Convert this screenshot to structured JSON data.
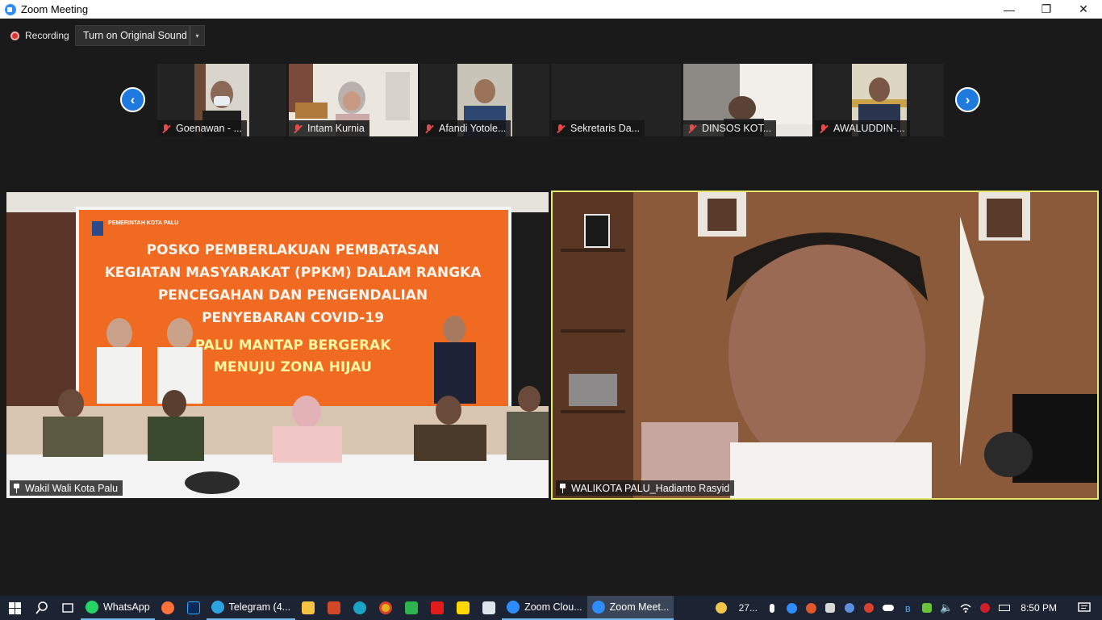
{
  "window": {
    "title": "Zoom Meeting",
    "minimize": "—",
    "restore": "❐",
    "close": "✕"
  },
  "toolbar": {
    "recording_label": "Recording",
    "original_sound_label": "Turn on Original Sound",
    "dropdown_glyph": "▾"
  },
  "gallery": {
    "prev_glyph": "‹",
    "next_glyph": "›",
    "thumbnails": [
      {
        "name": "Goenawan - ..."
      },
      {
        "name": "Intam Kurnia"
      },
      {
        "name": "Afandi Yotole..."
      },
      {
        "name": "Sekretaris Da..."
      },
      {
        "name": "DINSOS KOT..."
      },
      {
        "name": "AWALUDDIN-..."
      }
    ]
  },
  "videos": {
    "left": {
      "label": "Wakil Wali Kota Palu",
      "banner": {
        "org": "PEMERINTAH\nKOTA PALU",
        "line1": "POSKO PEMBERLAKUAN PEMBATASAN",
        "line2": "KEGIATAN MASYARAKAT (PPKM) DALAM RANGKA",
        "line3": "PENCEGAHAN DAN PENGENDALIAN",
        "line4": "PENYEBARAN COVID-19",
        "line5": "PALU MANTAP BERGERAK",
        "line6": "MENUJU ZONA HIJAU"
      }
    },
    "right": {
      "label": "WALIKOTA PALU_Hadianto Rasyid",
      "active_border": "#e6e86a"
    }
  },
  "taskbar": {
    "apps": [
      {
        "label": "WhatsApp"
      },
      {
        "label": "Telegram (4..."
      },
      {
        "label": "Zoom Clou..."
      },
      {
        "label": "Zoom Meet..."
      }
    ],
    "weather": "27...",
    "time": "8:50 PM"
  }
}
